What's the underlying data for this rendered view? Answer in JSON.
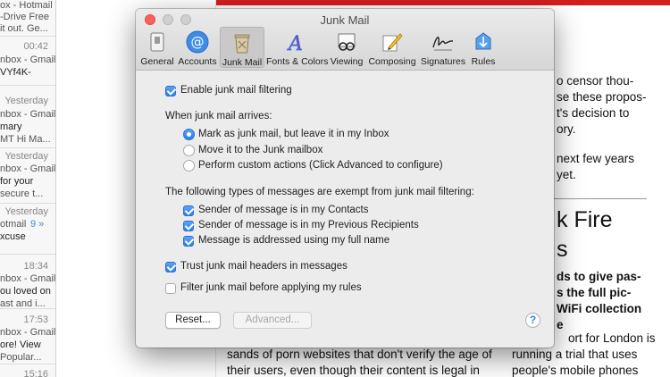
{
  "mail_list": {
    "items": [
      {
        "lines": [
          "ox - Hotmail",
          "-Drive Free",
          "it out. Ge..."
        ]
      },
      {
        "time": "00:42",
        "lines": [
          "nbox - Gmail",
          "VYf4K-"
        ]
      },
      {
        "time": "Yesterday",
        "lines": [
          "nbox - Gmail",
          "mary",
          "MT Hi Ma..."
        ]
      },
      {
        "time": "Yesterday",
        "lines": [
          "nbox - Gmail",
          "for your",
          "secure t..."
        ]
      },
      {
        "time": "Yesterday",
        "lines": [
          "otmail",
          "xcuse"
        ],
        "badge": "9 »"
      },
      {
        "time": "18:34",
        "lines": [
          "nbox - Gmail",
          "ou loved on",
          "ast and i..."
        ]
      },
      {
        "time": "17:53",
        "lines": [
          "nbox - Gmail",
          "ore! View",
          "Popular..."
        ]
      },
      {
        "time": "15:16",
        "lines": []
      }
    ]
  },
  "article": {
    "right_lines": [
      "o censor thou-",
      "se these propos-",
      "t's decision to",
      "ory."
    ],
    "right_lines2": [
      "next few years",
      "yet."
    ],
    "headline": [
      "k Fire",
      "s"
    ],
    "subhead": [
      "ds to give pas-",
      "s the full pic-",
      "WiFi collection",
      "e"
    ],
    "bottom_left": [
      "sands of porn websites that don't verify the age of",
      "their users, even though their content is legal in"
    ],
    "bottom_right": [
      "ort for London is",
      "running a trial that uses",
      "people's mobile phones"
    ]
  },
  "window": {
    "title": "Junk Mail",
    "tabs": [
      {
        "label": "General",
        "icon": "switch-icon"
      },
      {
        "label": "Accounts",
        "icon": "at-sign-icon"
      },
      {
        "label": "Junk Mail",
        "icon": "trash-bin-icon",
        "active": true
      },
      {
        "label": "Fonts & Colors",
        "icon": "font-letter-icon"
      },
      {
        "label": "Viewing",
        "icon": "glasses-icon"
      },
      {
        "label": "Composing",
        "icon": "pencil-icon"
      },
      {
        "label": "Signatures",
        "icon": "signature-icon"
      },
      {
        "label": "Rules",
        "icon": "rules-icon"
      }
    ]
  },
  "junk": {
    "enable_label": "Enable junk mail filtering",
    "enable_checked": true,
    "when_arrives_label": "When junk mail arrives:",
    "radio_options": [
      {
        "label": "Mark as junk mail, but leave it in my Inbox",
        "selected": true
      },
      {
        "label": "Move it to the Junk mailbox",
        "selected": false
      },
      {
        "label": "Perform custom actions (Click Advanced to configure)",
        "selected": false
      }
    ],
    "exempt_label": "The following types of messages are exempt from junk mail filtering:",
    "exempt_options": [
      {
        "label": "Sender of message is in my Contacts",
        "checked": true
      },
      {
        "label": "Sender of message is in my Previous Recipients",
        "checked": true
      },
      {
        "label": "Message is addressed using my full name",
        "checked": true
      }
    ],
    "trust_label": "Trust junk mail headers in messages",
    "trust_checked": true,
    "filter_before_label": "Filter junk mail before applying my rules",
    "filter_before_checked": false,
    "reset_button": "Reset...",
    "advanced_button": "Advanced...",
    "help_glyph": "?"
  },
  "colors": {
    "accent": "#2d7fe8",
    "close_button": "#fc605c",
    "article_red_bar": "#d41e1e"
  }
}
